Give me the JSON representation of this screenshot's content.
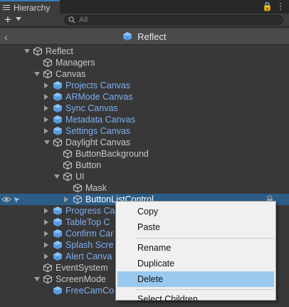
{
  "panel": {
    "tab_label": "Hierarchy",
    "lock_glyph": "🔒",
    "more_glyph": "⋮",
    "add_glyph": "+",
    "search_placeholder": "All",
    "scene_name": "Reflect"
  },
  "tree": [
    {
      "label": "Reflect",
      "prefab": false,
      "depth": 0,
      "arrow": "down"
    },
    {
      "label": "Managers",
      "prefab": false,
      "depth": 1,
      "arrow": "none"
    },
    {
      "label": "Canvas",
      "prefab": false,
      "depth": 1,
      "arrow": "down"
    },
    {
      "label": "Projects Canvas",
      "prefab": true,
      "depth": 2,
      "arrow": "right"
    },
    {
      "label": "ARMode Canvas",
      "prefab": true,
      "depth": 2,
      "arrow": "right"
    },
    {
      "label": "Sync Canvas",
      "prefab": true,
      "depth": 2,
      "arrow": "right"
    },
    {
      "label": "Metadata Canvas",
      "prefab": true,
      "depth": 2,
      "arrow": "right"
    },
    {
      "label": "Settings Canvas",
      "prefab": true,
      "depth": 2,
      "arrow": "right"
    },
    {
      "label": "Daylight Canvas",
      "prefab": false,
      "depth": 2,
      "arrow": "down"
    },
    {
      "label": "ButtonBackground",
      "prefab": false,
      "depth": 3,
      "arrow": "none"
    },
    {
      "label": "Button",
      "prefab": false,
      "depth": 3,
      "arrow": "none"
    },
    {
      "label": "UI",
      "prefab": false,
      "depth": 3,
      "arrow": "down"
    },
    {
      "label": "Mask",
      "prefab": false,
      "depth": 4,
      "arrow": "none"
    },
    {
      "label": "ButtonListControl",
      "prefab": false,
      "depth": 4,
      "arrow": "right",
      "selected": true
    },
    {
      "label": "Progress Ca",
      "prefab": true,
      "depth": 2,
      "arrow": "right"
    },
    {
      "label": "TableTop C",
      "prefab": true,
      "depth": 2,
      "arrow": "right"
    },
    {
      "label": "Confirm Car",
      "prefab": true,
      "depth": 2,
      "arrow": "right"
    },
    {
      "label": "Splash Scre",
      "prefab": true,
      "depth": 2,
      "arrow": "right"
    },
    {
      "label": "Alert Canva",
      "prefab": true,
      "depth": 2,
      "arrow": "right"
    },
    {
      "label": "EventSystem",
      "prefab": false,
      "depth": 1,
      "arrow": "none"
    },
    {
      "label": "ScreenMode",
      "prefab": false,
      "depth": 1,
      "arrow": "down"
    },
    {
      "label": "FreeCamCo",
      "prefab": true,
      "depth": 2,
      "arrow": "none"
    }
  ],
  "context_menu": {
    "items": [
      {
        "label": "Copy",
        "highlighted": false
      },
      {
        "label": "Paste",
        "highlighted": false
      },
      {
        "label": "Rename",
        "highlighted": false
      },
      {
        "label": "Duplicate",
        "highlighted": false
      },
      {
        "label": "Delete",
        "highlighted": true
      },
      {
        "label": "Select Children",
        "highlighted": false
      }
    ]
  },
  "colors": {
    "prefab_text": "#7eaef0",
    "selection": "#2c5d87",
    "menu_highlight": "#99c9ef"
  }
}
